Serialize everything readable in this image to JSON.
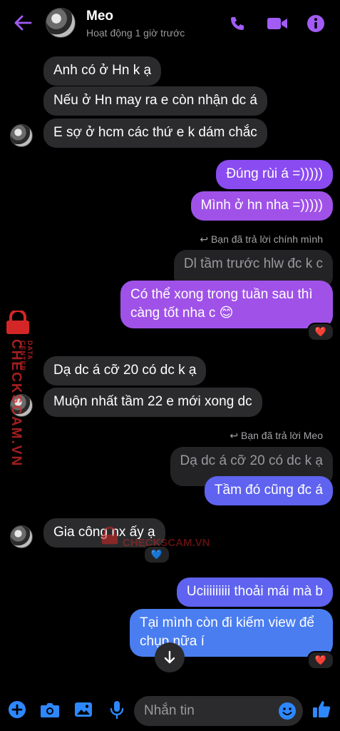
{
  "header": {
    "name": "Meo",
    "status": "Hoạt động 1 giờ trước"
  },
  "messages": [
    {
      "text": "Anh có ở Hn k ạ"
    },
    {
      "text": "Nếu ở Hn may ra e còn nhận dc á"
    },
    {
      "text": "E sợ ở hcm các thứ e k dám chắc"
    },
    {
      "text": "Đúng rùi á =)))))"
    },
    {
      "text": "Mình ở hn nha =)))))"
    },
    {
      "reply_note": "Bạn đã trả lời chính mình"
    },
    {
      "text": "Dl tầm trước hlw đc k c"
    },
    {
      "text_line1": "Có thể xong trong tuần sau thì",
      "text_line2": "càng tốt nha c 😊",
      "reaction": "❤️"
    },
    {
      "text": "Dạ dc á cỡ 20 có dc k ạ"
    },
    {
      "text": "Muộn nhất tầm 22 e mới xong dc"
    },
    {
      "reply_note": "Bạn đã trả lời Meo"
    },
    {
      "text": "Dạ dc á cỡ 20 có dc k ạ"
    },
    {
      "text": "Tầm đó cũng đc á"
    },
    {
      "text": "Gia công nx ấy ạ",
      "reaction": "💙"
    },
    {
      "text": "Uciiiiiiiii thoải mái mà b"
    },
    {
      "text_line1": "Tại mình còn đi kiếm view để",
      "text_line2": "chụp nữa í",
      "reaction": "❤️"
    }
  ],
  "composer": {
    "placeholder": "Nhắn tin"
  },
  "watermark": {
    "text": "CHECKSCAM.VN",
    "sub": "DATA CENTER"
  },
  "colors": {
    "accent": "#a25cf5",
    "incoming": "#2b2b2d",
    "like": "#2d88ff"
  }
}
